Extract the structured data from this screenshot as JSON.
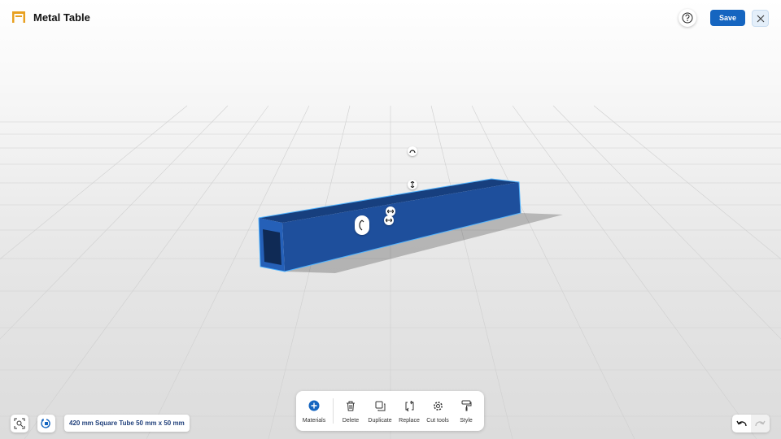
{
  "header": {
    "title": "Metal Table",
    "save_label": "Save",
    "icons": {
      "logo": "table-frame-icon",
      "help": "question-circle-icon",
      "close": "close-icon"
    }
  },
  "toolbar": {
    "items": [
      {
        "label": "Materials",
        "icon": "plus-circle-icon"
      },
      {
        "label": "Delete",
        "icon": "trash-icon"
      },
      {
        "label": "Duplicate",
        "icon": "duplicate-icon"
      },
      {
        "label": "Replace",
        "icon": "replace-icon"
      },
      {
        "label": "Cut tools",
        "icon": "gear-icon"
      },
      {
        "label": "Style",
        "icon": "paint-roller-icon"
      }
    ]
  },
  "selection": {
    "label": "420 mm Square Tube 50 mm x 50 mm"
  },
  "colors": {
    "accent": "#1565c0",
    "tube": "#1e4f9c",
    "tube_top": "#173f7e",
    "tube_end": "#2560b8",
    "selection_outline": "#4fb3ff"
  }
}
